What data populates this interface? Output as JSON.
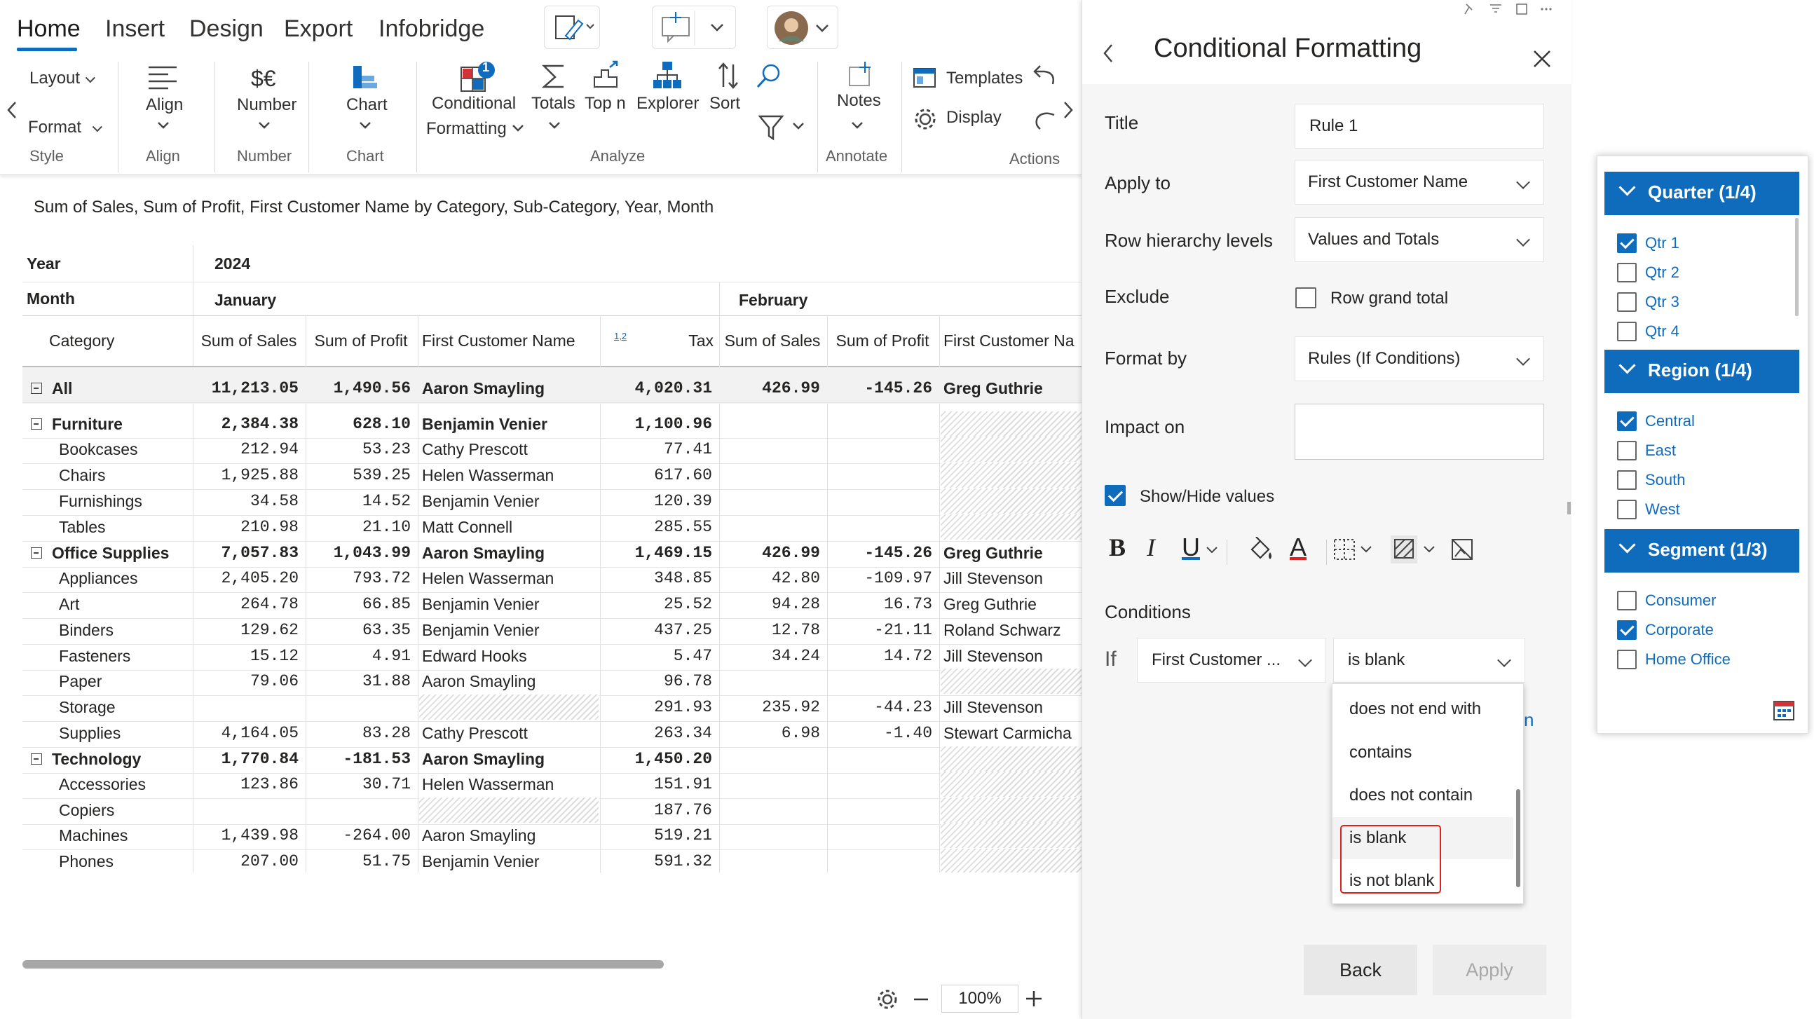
{
  "tabs": [
    "Home",
    "Insert",
    "Design",
    "Export",
    "Infobridge"
  ],
  "ribbon": {
    "layout": "Layout",
    "format": "Format",
    "style_group": "Style",
    "align": "Align",
    "align_group": "Align",
    "number_symbol": "$€",
    "number": "Number",
    "number_group": "Number",
    "chart": "Chart",
    "chart_group": "Chart",
    "cf_badge": "1",
    "cf_line1": "Conditional",
    "cf_line2": "Formatting",
    "totals": "Totals",
    "topn": "Top n",
    "explorer": "Explorer",
    "sort": "Sort",
    "analyze_group": "Analyze",
    "notes": "Notes",
    "annotate_group": "Annotate",
    "templates": "Templates",
    "display": "Display",
    "actions_group": "Actions"
  },
  "report": {
    "subtitle": "Sum of Sales, Sum of Profit, First Customer Name by Category, Sub-Category, Year, Month",
    "year_label": "Year",
    "year": "2024",
    "month_label": "Month",
    "month1": "January",
    "month2": "February",
    "category_label": "Category",
    "columns": [
      "Sum of Sales",
      "Sum of Profit",
      "First Customer Name",
      "Tax",
      "Sum of Sales",
      "Sum of Profit",
      "First Customer Na"
    ],
    "tax_icon": "1,2",
    "rows": [
      {
        "label": "All",
        "level": 0,
        "bold": true,
        "expand": true,
        "c": [
          "11,213.05",
          "1,490.56",
          "Aaron Smayling",
          "4,020.31",
          "426.99",
          "-145.26",
          "Greg Guthrie"
        ]
      },
      {
        "label": "Furniture",
        "level": 0,
        "bold": true,
        "expand": true,
        "c": [
          "2,384.38",
          "628.10",
          "Benjamin Venier",
          "1,100.96",
          "",
          "",
          ""
        ]
      },
      {
        "label": "Bookcases",
        "level": 1,
        "c": [
          "212.94",
          "53.23",
          "Cathy Prescott",
          "77.41",
          "",
          "",
          ""
        ]
      },
      {
        "label": "Chairs",
        "level": 1,
        "c": [
          "1,925.88",
          "539.25",
          "Helen Wasserman",
          "617.60",
          "",
          "",
          ""
        ]
      },
      {
        "label": "Furnishings",
        "level": 1,
        "c": [
          "34.58",
          "14.52",
          "Benjamin Venier",
          "120.39",
          "",
          "",
          ""
        ]
      },
      {
        "label": "Tables",
        "level": 1,
        "c": [
          "210.98",
          "21.10",
          "Matt Connell",
          "285.55",
          "",
          "",
          ""
        ]
      },
      {
        "label": "Office Supplies",
        "level": 0,
        "bold": true,
        "expand": true,
        "c": [
          "7,057.83",
          "1,043.99",
          "Aaron Smayling",
          "1,469.15",
          "426.99",
          "-145.26",
          "Greg Guthrie"
        ]
      },
      {
        "label": "Appliances",
        "level": 1,
        "c": [
          "2,405.20",
          "793.72",
          "Helen Wasserman",
          "348.85",
          "42.80",
          "-109.97",
          "Jill Stevenson"
        ]
      },
      {
        "label": "Art",
        "level": 1,
        "c": [
          "264.78",
          "66.85",
          "Benjamin Venier",
          "25.52",
          "94.28",
          "16.73",
          "Greg Guthrie"
        ]
      },
      {
        "label": "Binders",
        "level": 1,
        "c": [
          "129.62",
          "63.35",
          "Benjamin Venier",
          "437.25",
          "12.78",
          "-21.11",
          "Roland Schwarz"
        ]
      },
      {
        "label": "Fasteners",
        "level": 1,
        "c": [
          "15.12",
          "4.91",
          "Edward Hooks",
          "5.47",
          "34.24",
          "14.72",
          "Jill Stevenson"
        ]
      },
      {
        "label": "Paper",
        "level": 1,
        "c": [
          "79.06",
          "31.88",
          "Aaron Smayling",
          "96.78",
          "",
          "",
          ""
        ]
      },
      {
        "label": "Storage",
        "level": 1,
        "c": [
          "",
          "",
          "",
          "291.93",
          "235.92",
          "-44.23",
          "Jill Stevenson"
        ]
      },
      {
        "label": "Supplies",
        "level": 1,
        "c": [
          "4,164.05",
          "83.28",
          "Cathy Prescott",
          "263.34",
          "6.98",
          "-1.40",
          "Stewart Carmicha"
        ]
      },
      {
        "label": "Technology",
        "level": 0,
        "bold": true,
        "expand": true,
        "c": [
          "1,770.84",
          "-181.53",
          "Aaron Smayling",
          "1,450.20",
          "",
          "",
          ""
        ]
      },
      {
        "label": "Accessories",
        "level": 1,
        "c": [
          "123.86",
          "30.71",
          "Helen Wasserman",
          "151.91",
          "",
          "",
          ""
        ]
      },
      {
        "label": "Copiers",
        "level": 1,
        "c": [
          "",
          "",
          "",
          "187.76",
          "",
          "",
          ""
        ]
      },
      {
        "label": "Machines",
        "level": 1,
        "c": [
          "1,439.98",
          "-264.00",
          "Aaron Smayling",
          "519.21",
          "",
          "",
          ""
        ]
      },
      {
        "label": "Phones",
        "level": 1,
        "c": [
          "207.00",
          "51.75",
          "Benjamin Venier",
          "591.32",
          "",
          "",
          ""
        ]
      }
    ]
  },
  "zoom": "100%",
  "panel": {
    "title": "Conditional Formatting",
    "title_label": "Title",
    "title_value": "Rule 1",
    "apply_to_label": "Apply to",
    "apply_to_value": "First Customer Name",
    "row_levels_label": "Row hierarchy levels",
    "row_levels_value": "Values and Totals",
    "exclude_label": "Exclude",
    "exclude_option": "Row grand total",
    "format_by_label": "Format by",
    "format_by_value": "Rules (If Conditions)",
    "impact_label": "Impact on",
    "impact_value": "",
    "show_hide": "Show/Hide values",
    "bold_glyph": "B",
    "italic_glyph": "I",
    "underline_glyph": "U",
    "font_color_glyph": "A",
    "conditions_label": "Conditions",
    "if_label": "If",
    "if_field": "First Customer ...",
    "if_operator": "is blank",
    "partial_link": "n",
    "dropdown": [
      "does not end with",
      "contains",
      "does not contain",
      "is blank",
      "is not blank"
    ],
    "back": "Back",
    "apply": "Apply"
  },
  "slicers": [
    {
      "title": "Quarter (1/4)",
      "items": [
        {
          "label": "Qtr 1",
          "checked": true
        },
        {
          "label": "Qtr 2",
          "checked": false
        },
        {
          "label": "Qtr 3",
          "checked": false
        },
        {
          "label": "Qtr 4",
          "checked": false
        }
      ]
    },
    {
      "title": "Region (1/4)",
      "items": [
        {
          "label": "Central",
          "checked": true
        },
        {
          "label": "East",
          "checked": false
        },
        {
          "label": "South",
          "checked": false
        },
        {
          "label": "West",
          "checked": false
        }
      ]
    },
    {
      "title": "Segment (1/3)",
      "items": [
        {
          "label": "Consumer",
          "checked": false
        },
        {
          "label": "Corporate",
          "checked": true
        },
        {
          "label": "Home Office",
          "checked": false
        }
      ]
    }
  ],
  "colors": {
    "accent": "#0f6cbd",
    "highlight": "#e02020"
  }
}
